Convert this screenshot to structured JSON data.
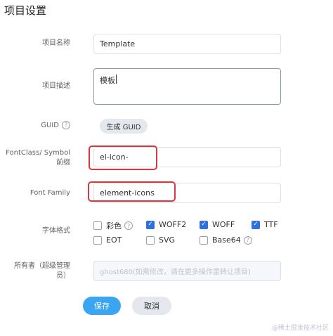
{
  "page": {
    "title": "项目设置"
  },
  "form": {
    "name": {
      "label": "项目名称",
      "value": "Template"
    },
    "description": {
      "label": "项目描述",
      "value": "模板"
    },
    "guid": {
      "label": "GUID",
      "button": "生成 GUID",
      "help": "?"
    },
    "font_class": {
      "label": "FontClass/ Symbol 前缀",
      "value": "el-icon-"
    },
    "font_family": {
      "label": "Font Family",
      "value": "element-icons"
    },
    "font_format": {
      "label": "字体格式",
      "options": [
        {
          "label": "彩色",
          "checked": false,
          "help": "?"
        },
        {
          "label": "WOFF2",
          "checked": true
        },
        {
          "label": "WOFF",
          "checked": true
        },
        {
          "label": "TTF",
          "checked": true
        },
        {
          "label": "EOT",
          "checked": false
        },
        {
          "label": "SVG",
          "checked": false
        },
        {
          "label": "Base64",
          "checked": false,
          "help": "?"
        }
      ]
    },
    "owner": {
      "label": "所有者（超级管理员）",
      "value": "ghost680(如需修改，请在更多操作里转让项目)"
    }
  },
  "actions": {
    "save": "保存",
    "cancel": "取消"
  },
  "watermark": "@稀土掘金技术社区",
  "colors": {
    "primary": "#3aa5f0",
    "checkbox": "#2f6fde",
    "highlight": "#d9363e"
  },
  "icons": {
    "check": "✓"
  }
}
